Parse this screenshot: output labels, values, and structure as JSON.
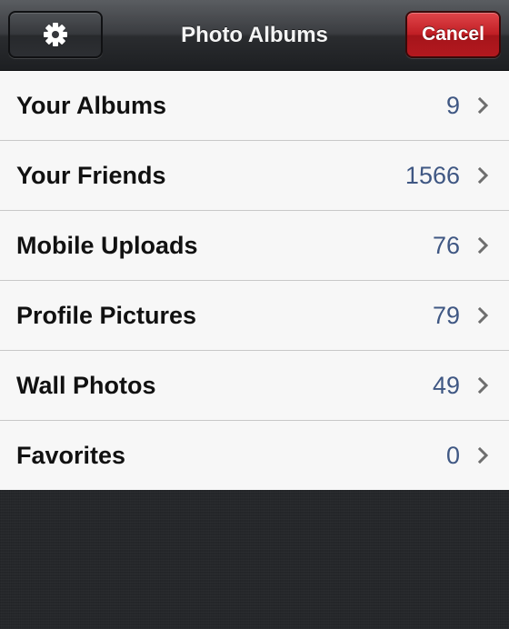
{
  "navbar": {
    "title": "Photo Albums",
    "settings_icon": "gear-icon",
    "cancel_label": "Cancel"
  },
  "colors": {
    "cancel_button": "#c01e24",
    "count_text": "#3f5783",
    "row_background": "#f7f7f7",
    "navbar_background": "#2a2c2f"
  },
  "albums": [
    {
      "label": "Your Albums",
      "count": "9"
    },
    {
      "label": "Your Friends",
      "count": "1566"
    },
    {
      "label": "Mobile Uploads",
      "count": "76"
    },
    {
      "label": "Profile Pictures",
      "count": "79"
    },
    {
      "label": "Wall Photos",
      "count": "49"
    },
    {
      "label": "Favorites",
      "count": "0"
    }
  ]
}
